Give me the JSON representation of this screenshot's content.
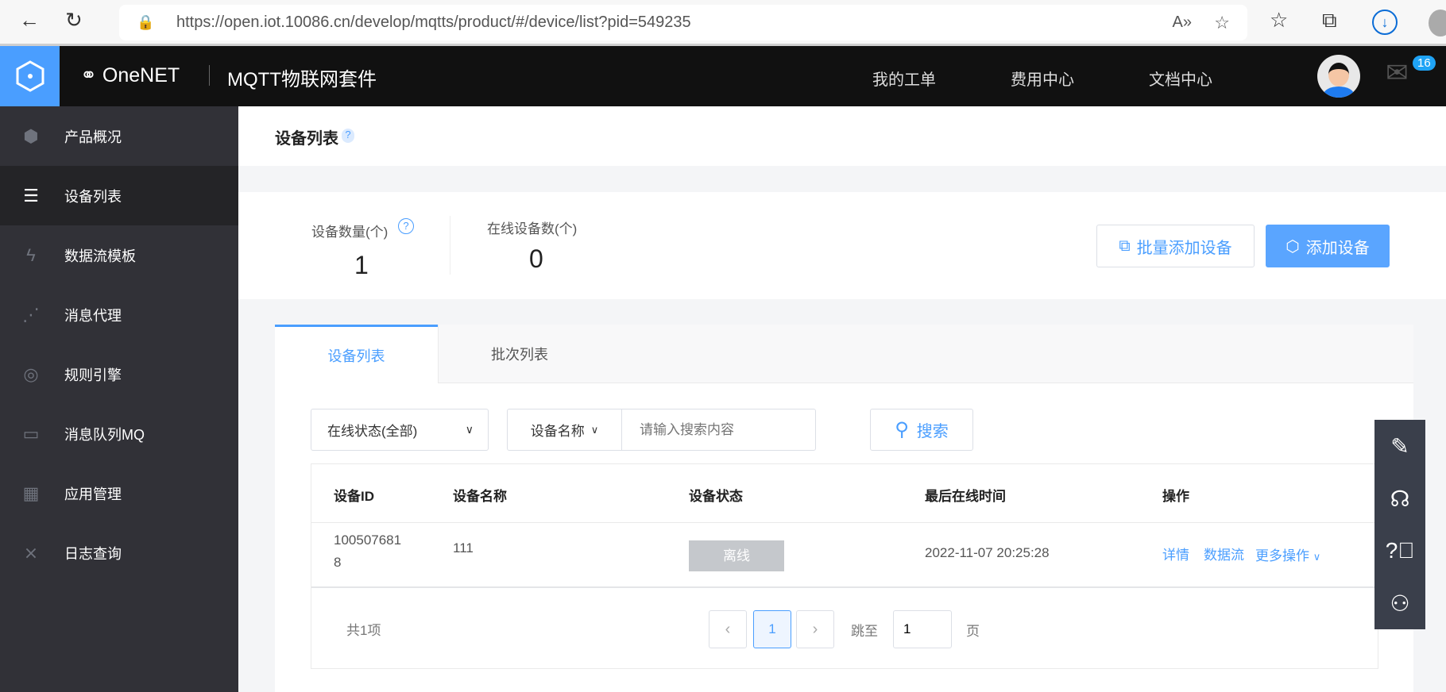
{
  "browser": {
    "url": "https://open.iot.10086.cn/develop/mqtts/product/#/device/list?pid=549235"
  },
  "header": {
    "brand": "OneNET",
    "product": "MQTT物联网套件",
    "nav": [
      "我的工单",
      "费用中心",
      "文档中心"
    ],
    "mail_count": "16"
  },
  "sidebar": {
    "items": [
      {
        "label": "产品概况",
        "icon": "cube-icon"
      },
      {
        "label": "设备列表",
        "icon": "list-icon"
      },
      {
        "label": "数据流模板",
        "icon": "graph-icon"
      },
      {
        "label": "消息代理",
        "icon": "broker-icon"
      },
      {
        "label": "规则引擎",
        "icon": "target-icon"
      },
      {
        "label": "消息队列MQ",
        "icon": "queue-icon"
      },
      {
        "label": "应用管理",
        "icon": "grid-icon"
      },
      {
        "label": "日志查询",
        "icon": "log-icon"
      }
    ],
    "active": 1
  },
  "page": {
    "title": "设备列表",
    "help": "?"
  },
  "stats": {
    "device_count_label": "设备数量(个)",
    "device_count": "1",
    "online_label": "在线设备数(个)",
    "online_count": "0",
    "help": "?"
  },
  "actions": {
    "batch_add": "批量添加设备",
    "add": "添加设备"
  },
  "tabs": [
    "设备列表",
    "批次列表"
  ],
  "filter": {
    "status_select": "在线状态(全部)",
    "field_select": "设备名称",
    "search_placeholder": "请输入搜索内容",
    "search_button": "搜索"
  },
  "table": {
    "headers": [
      "设备ID",
      "设备名称",
      "设备状态",
      "最后在线时间",
      "操作"
    ],
    "rows": [
      {
        "id_line1": "100507681",
        "id_line2": "8",
        "name": "111",
        "status": "离线",
        "last_online": "2022-11-07 20:25:28",
        "ops": [
          "详情",
          "数据流",
          "更多操作"
        ]
      }
    ]
  },
  "pagination": {
    "total": "共1项",
    "current": "1",
    "prev": "‹",
    "next": "›",
    "jump_label": "跳至",
    "jump_value": "1",
    "page_suffix": "页"
  },
  "colors": {
    "accent": "#4a9eff",
    "sidebar": "#313137",
    "header": "#111111",
    "offline": "#c5c8cc"
  }
}
